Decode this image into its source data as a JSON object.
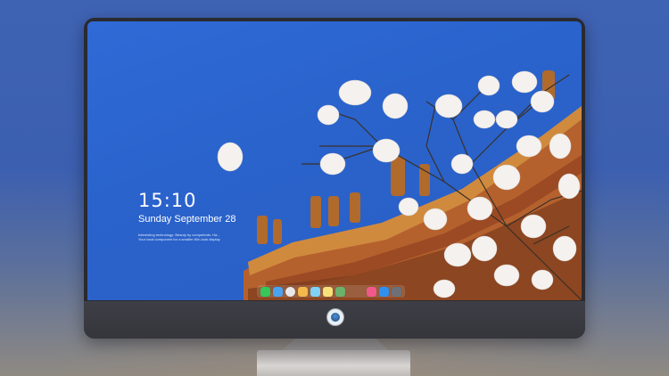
{
  "lockscreen": {
    "time": "15:10",
    "date": "Sunday September 28",
    "caption_line1": "Interesting technology: Beauty by competents. Ha...",
    "caption_line2": "Your local component for a smaller Win-look display"
  },
  "dock": {
    "icons": [
      {
        "name": "messages-icon",
        "color": "#35c759"
      },
      {
        "name": "finder-icon",
        "color": "#4aa3f0"
      },
      {
        "name": "safari-icon",
        "color": "#e8e8ea"
      },
      {
        "name": "photos-icon",
        "color": "#f2b84b"
      },
      {
        "name": "launchpad-icon",
        "color": "#7fd1f5"
      },
      {
        "name": "notes-icon",
        "color": "#f7e27a"
      },
      {
        "name": "preview-icon",
        "color": "#6cb16c"
      },
      {
        "name": "music-icon",
        "color": "#f05a8a"
      },
      {
        "name": "appstore-icon",
        "color": "#2e8ff0"
      },
      {
        "name": "camera-icon",
        "color": "#6e7077"
      }
    ]
  },
  "colors": {
    "sky": "#2b63cc",
    "bezel": "#35363c",
    "stand": "#c9c6c4"
  }
}
